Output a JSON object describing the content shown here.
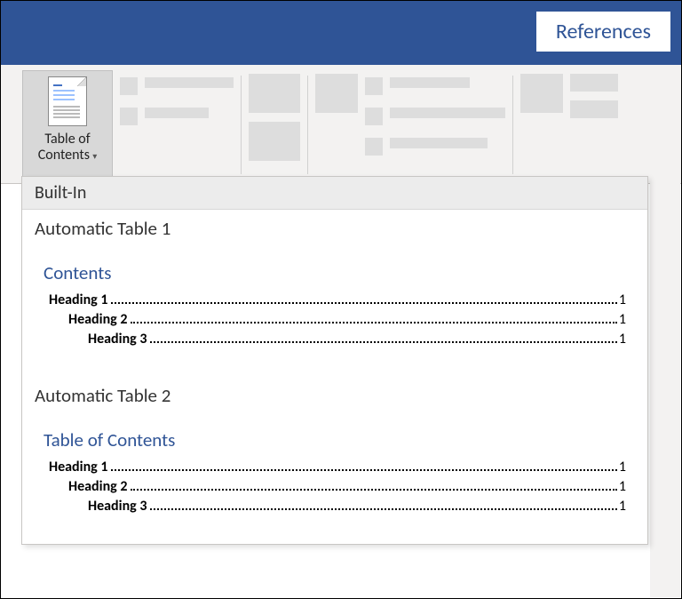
{
  "tab_label": "References",
  "toc_button": {
    "line1": "Table of",
    "line2": "Contents"
  },
  "dropdown": {
    "header": "Built-In",
    "options": [
      {
        "label": "Automatic  Table 1",
        "title": "Contents",
        "rows": [
          {
            "text": "Heading 1",
            "page": "1",
            "level": 1
          },
          {
            "text": "Heading 2",
            "page": "1",
            "level": 2
          },
          {
            "text": "Heading 3",
            "page": "1",
            "level": 3
          }
        ]
      },
      {
        "label": "Automatic  Table 2",
        "title": "Table of Contents",
        "rows": [
          {
            "text": "Heading 1",
            "page": "1",
            "level": 1
          },
          {
            "text": "Heading 2",
            "page": "1",
            "level": 2
          },
          {
            "text": "Heading 3",
            "page": "1",
            "level": 3
          }
        ]
      }
    ]
  }
}
